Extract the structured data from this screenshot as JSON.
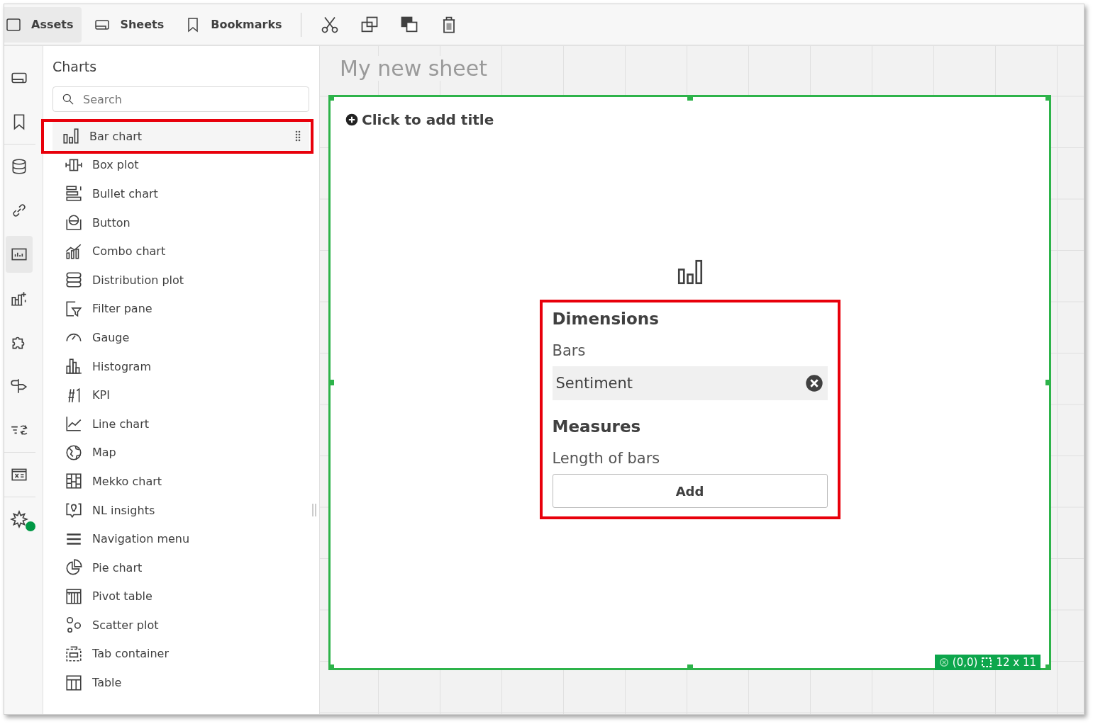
{
  "toolbar": {
    "tabs": [
      {
        "label": "Assets",
        "selected": true
      },
      {
        "label": "Sheets",
        "selected": false
      },
      {
        "label": "Bookmarks",
        "selected": false
      }
    ]
  },
  "rail": [
    {
      "selected": false
    },
    {
      "selected": false
    },
    {
      "selected": false
    },
    {
      "selected": false
    },
    {
      "selected": true
    },
    {
      "selected": false
    },
    {
      "selected": false
    },
    {
      "selected": false
    },
    {
      "selected": false
    },
    {
      "selected": false
    },
    {
      "selected": false
    }
  ],
  "rail_status_dot": true,
  "panel": {
    "title": "Charts",
    "search": {
      "placeholder": "Search"
    },
    "items": [
      {
        "label": "Bar chart",
        "highlighted": true
      },
      {
        "label": "Box plot",
        "highlighted": false
      },
      {
        "label": "Bullet chart",
        "highlighted": false
      },
      {
        "label": "Button",
        "highlighted": false
      },
      {
        "label": "Combo chart",
        "highlighted": false
      },
      {
        "label": "Distribution plot",
        "highlighted": false
      },
      {
        "label": "Filter pane",
        "highlighted": false
      },
      {
        "label": "Gauge",
        "highlighted": false
      },
      {
        "label": "Histogram",
        "highlighted": false
      },
      {
        "label": "KPI",
        "highlighted": false
      },
      {
        "label": "Line chart",
        "highlighted": false
      },
      {
        "label": "Map",
        "highlighted": false
      },
      {
        "label": "Mekko chart",
        "highlighted": false
      },
      {
        "label": "NL insights",
        "highlighted": false
      },
      {
        "label": "Navigation menu",
        "highlighted": false
      },
      {
        "label": "Pie chart",
        "highlighted": false
      },
      {
        "label": "Pivot table",
        "highlighted": false
      },
      {
        "label": "Scatter plot",
        "highlighted": false
      },
      {
        "label": "Tab container",
        "highlighted": false
      },
      {
        "label": "Table",
        "highlighted": false
      }
    ]
  },
  "sheet": {
    "title": "My new sheet",
    "object": {
      "title_placeholder": "Click to add title",
      "highlighted": true,
      "dimensions": {
        "heading": "Dimensions",
        "label": "Bars",
        "value": "Sentiment"
      },
      "measures": {
        "heading": "Measures",
        "label": "Length of bars",
        "button": "Add"
      },
      "position": "(0,0)",
      "size": "12 x 11"
    }
  }
}
